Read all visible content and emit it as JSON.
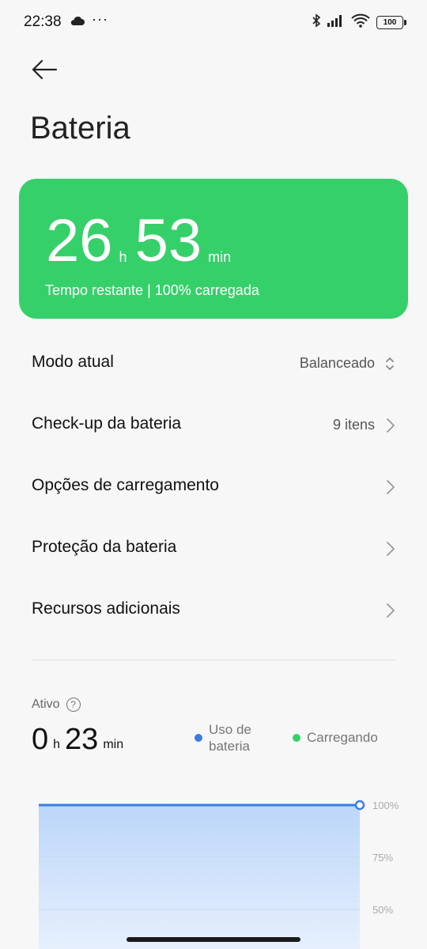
{
  "status_bar": {
    "time": "22:38",
    "dots": "···",
    "battery": "100"
  },
  "page": {
    "title": "Bateria"
  },
  "summary": {
    "hours": "26",
    "hours_unit": "h",
    "minutes": "53",
    "minutes_unit": "min",
    "subtitle": "Tempo restante | 100% carregada",
    "color": "#36d06a"
  },
  "settings": [
    {
      "label": "Modo atual",
      "value": "Balanceado",
      "icon": "up-down-chevron-icon"
    },
    {
      "label": "Check-up da bateria",
      "value": "9 itens",
      "icon": "chevron-right-icon"
    },
    {
      "label": "Opções de carregamento",
      "value": "",
      "icon": "chevron-right-icon"
    },
    {
      "label": "Proteção da bateria",
      "value": "",
      "icon": "chevron-right-icon"
    },
    {
      "label": "Recursos adicionais",
      "value": "",
      "icon": "chevron-right-icon"
    }
  ],
  "usage": {
    "active_label": "Ativo",
    "hours": "0",
    "hours_unit": "h",
    "minutes": "23",
    "minutes_unit": "min",
    "legend": [
      {
        "label_line1": "Uso de",
        "label_line2": "bateria",
        "color": "#3a7de0"
      },
      {
        "label": "Carregando",
        "color": "#36d06a"
      }
    ]
  },
  "chart_data": {
    "type": "area",
    "y_ticks": [
      "100%",
      "75%",
      "50%"
    ],
    "ylim": [
      0,
      100
    ],
    "series": [
      {
        "values": [
          100,
          100
        ]
      }
    ],
    "grid": true,
    "line_color": "#3a7de0"
  }
}
